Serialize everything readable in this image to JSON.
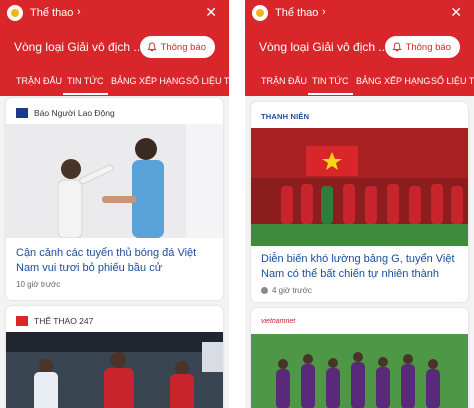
{
  "panes": [
    {
      "section": "Thể thao",
      "title": "Vòng loại Giải vô địch ...",
      "follow_label": "Thông báo",
      "tabs": [
        "TRẬN ĐẤU",
        "TIN TỨC",
        "BẢNG XẾP HẠNG",
        "SỐ LIỆU THỐ"
      ],
      "active_tab": "TIN TỨC",
      "cards": [
        {
          "source": "Báo Người Lao Động",
          "headline": "Cận cảnh các tuyển thủ bóng đá Việt Nam vui tươi bỏ phiếu bầu cử",
          "time": "10 giờ trước"
        },
        {
          "source": "THỂ THAO 247",
          "headline": "",
          "time": ""
        }
      ]
    },
    {
      "section": "Thể thao",
      "title": "Vòng loại Giải vô địch ...",
      "follow_label": "Thông báo",
      "tabs": [
        "TRẬN ĐẤU",
        "TIN TỨC",
        "BẢNG XẾP HẠNG",
        "SỐ LIỆU THỐ"
      ],
      "active_tab": "TIN TỨC",
      "cards": [
        {
          "source": "THANH NIÊN",
          "headline": "Diễn biến khó lường bảng G, tuyển Việt Nam có thể bất chiến tự nhiên thành",
          "time": "4 giờ trước"
        },
        {
          "source": "vietnamnet",
          "headline": "",
          "time": ""
        }
      ]
    }
  ],
  "colors": {
    "header_red": "#d8262a",
    "link_blue": "#1a4c9b",
    "page_bg": "#f3f3f3"
  }
}
